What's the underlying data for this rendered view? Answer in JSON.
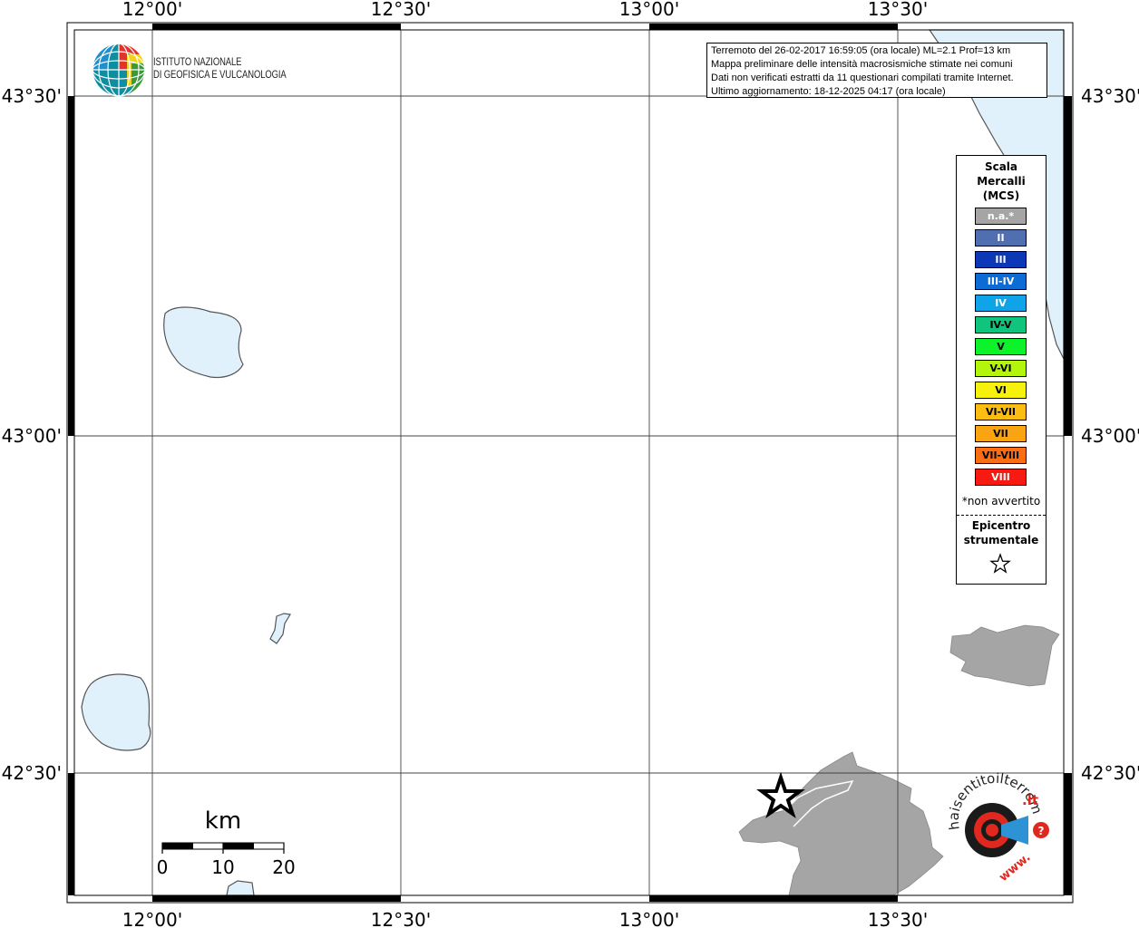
{
  "map": {
    "longitude_labels": [
      "12°00'",
      "12°30'",
      "13°00'",
      "13°30'"
    ],
    "latitude_labels": [
      "43°30'",
      "43°00'",
      "42°30'"
    ],
    "colors": {
      "water": "#e1f1fc",
      "water_outline": "#555555",
      "land_intensity_na": "#a5a5a5",
      "frame": "#000000"
    }
  },
  "info_box": {
    "line1": "Terremoto del 26-02-2017 16:59:05 (ora locale) ML=2.1 Prof=13 km",
    "line2": "Mappa preliminare delle intensità macrosismiche stimate nei comuni",
    "line3": "Dati non verificati estratti da 11 questionari compilati tramite Internet.",
    "line4": "Ultimo aggiornamento: 18-12-2025 04:17 (ora locale)"
  },
  "logo": {
    "line1": "ISTITUTO NAZIONALE",
    "line2": "DI GEOFISICA E VULCANOLOGIA"
  },
  "legend": {
    "title_line1": "Scala",
    "title_line2": "Mercalli",
    "title_line3": "(MCS)",
    "items": [
      {
        "label": "n.a.*",
        "color": "#a5a5a5",
        "text_color": "#ffffff"
      },
      {
        "label": "II",
        "color": "#4f6fb0",
        "text_color": "#ffffff"
      },
      {
        "label": "III",
        "color": "#0c37b7",
        "text_color": "#ffffff"
      },
      {
        "label": "III-IV",
        "color": "#0d6bd5",
        "text_color": "#ffffff"
      },
      {
        "label": "IV",
        "color": "#0fa3e8",
        "text_color": "#ffffff"
      },
      {
        "label": "IV-V",
        "color": "#10c47d",
        "text_color": "#000000"
      },
      {
        "label": "V",
        "color": "#0ef22a",
        "text_color": "#000000"
      },
      {
        "label": "V-VI",
        "color": "#b4f50d",
        "text_color": "#000000"
      },
      {
        "label": "VI",
        "color": "#f6f20c",
        "text_color": "#000000"
      },
      {
        "label": "VI-VII",
        "color": "#fbbd12",
        "text_color": "#000000"
      },
      {
        "label": "VII",
        "color": "#fba412",
        "text_color": "#000000"
      },
      {
        "label": "VII-VIII",
        "color": "#fb6d12",
        "text_color": "#000000"
      },
      {
        "label": "VIII",
        "color": "#f81a10",
        "text_color": "#ffffff"
      }
    ],
    "note": "*non avvertito",
    "epicenter_line1": "Epicentro",
    "epicenter_line2": "strumentale",
    "epicenter_icon": "star-outline-icon"
  },
  "scale_bar": {
    "unit": "km",
    "tick0": "0",
    "tick1": "10",
    "tick2": "20"
  },
  "badge": {
    "text_main": "haisentitoilterremoto",
    "text_tld": ".it",
    "text_www": "www."
  }
}
